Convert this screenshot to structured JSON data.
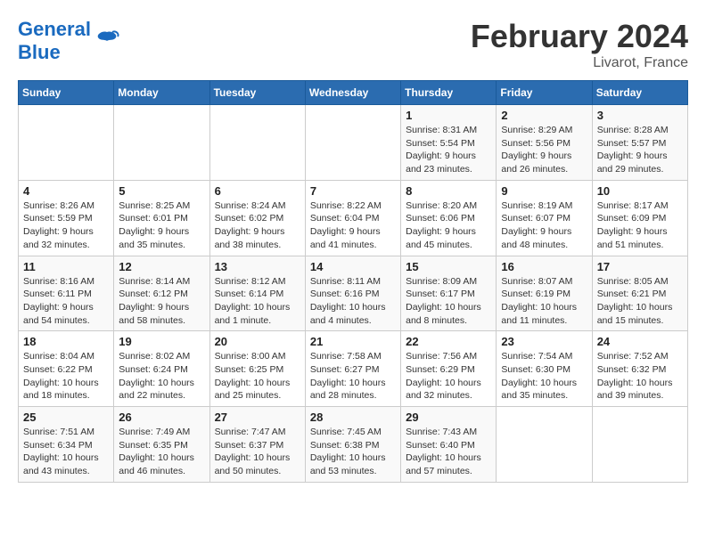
{
  "header": {
    "logo_general": "General",
    "logo_blue": "Blue",
    "month_title": "February 2024",
    "location": "Livarot, France"
  },
  "days_of_week": [
    "Sunday",
    "Monday",
    "Tuesday",
    "Wednesday",
    "Thursday",
    "Friday",
    "Saturday"
  ],
  "weeks": [
    [
      {
        "day": "",
        "info": ""
      },
      {
        "day": "",
        "info": ""
      },
      {
        "day": "",
        "info": ""
      },
      {
        "day": "",
        "info": ""
      },
      {
        "day": "1",
        "info": "Sunrise: 8:31 AM\nSunset: 5:54 PM\nDaylight: 9 hours\nand 23 minutes."
      },
      {
        "day": "2",
        "info": "Sunrise: 8:29 AM\nSunset: 5:56 PM\nDaylight: 9 hours\nand 26 minutes."
      },
      {
        "day": "3",
        "info": "Sunrise: 8:28 AM\nSunset: 5:57 PM\nDaylight: 9 hours\nand 29 minutes."
      }
    ],
    [
      {
        "day": "4",
        "info": "Sunrise: 8:26 AM\nSunset: 5:59 PM\nDaylight: 9 hours\nand 32 minutes."
      },
      {
        "day": "5",
        "info": "Sunrise: 8:25 AM\nSunset: 6:01 PM\nDaylight: 9 hours\nand 35 minutes."
      },
      {
        "day": "6",
        "info": "Sunrise: 8:24 AM\nSunset: 6:02 PM\nDaylight: 9 hours\nand 38 minutes."
      },
      {
        "day": "7",
        "info": "Sunrise: 8:22 AM\nSunset: 6:04 PM\nDaylight: 9 hours\nand 41 minutes."
      },
      {
        "day": "8",
        "info": "Sunrise: 8:20 AM\nSunset: 6:06 PM\nDaylight: 9 hours\nand 45 minutes."
      },
      {
        "day": "9",
        "info": "Sunrise: 8:19 AM\nSunset: 6:07 PM\nDaylight: 9 hours\nand 48 minutes."
      },
      {
        "day": "10",
        "info": "Sunrise: 8:17 AM\nSunset: 6:09 PM\nDaylight: 9 hours\nand 51 minutes."
      }
    ],
    [
      {
        "day": "11",
        "info": "Sunrise: 8:16 AM\nSunset: 6:11 PM\nDaylight: 9 hours\nand 54 minutes."
      },
      {
        "day": "12",
        "info": "Sunrise: 8:14 AM\nSunset: 6:12 PM\nDaylight: 9 hours\nand 58 minutes."
      },
      {
        "day": "13",
        "info": "Sunrise: 8:12 AM\nSunset: 6:14 PM\nDaylight: 10 hours\nand 1 minute."
      },
      {
        "day": "14",
        "info": "Sunrise: 8:11 AM\nSunset: 6:16 PM\nDaylight: 10 hours\nand 4 minutes."
      },
      {
        "day": "15",
        "info": "Sunrise: 8:09 AM\nSunset: 6:17 PM\nDaylight: 10 hours\nand 8 minutes."
      },
      {
        "day": "16",
        "info": "Sunrise: 8:07 AM\nSunset: 6:19 PM\nDaylight: 10 hours\nand 11 minutes."
      },
      {
        "day": "17",
        "info": "Sunrise: 8:05 AM\nSunset: 6:21 PM\nDaylight: 10 hours\nand 15 minutes."
      }
    ],
    [
      {
        "day": "18",
        "info": "Sunrise: 8:04 AM\nSunset: 6:22 PM\nDaylight: 10 hours\nand 18 minutes."
      },
      {
        "day": "19",
        "info": "Sunrise: 8:02 AM\nSunset: 6:24 PM\nDaylight: 10 hours\nand 22 minutes."
      },
      {
        "day": "20",
        "info": "Sunrise: 8:00 AM\nSunset: 6:25 PM\nDaylight: 10 hours\nand 25 minutes."
      },
      {
        "day": "21",
        "info": "Sunrise: 7:58 AM\nSunset: 6:27 PM\nDaylight: 10 hours\nand 28 minutes."
      },
      {
        "day": "22",
        "info": "Sunrise: 7:56 AM\nSunset: 6:29 PM\nDaylight: 10 hours\nand 32 minutes."
      },
      {
        "day": "23",
        "info": "Sunrise: 7:54 AM\nSunset: 6:30 PM\nDaylight: 10 hours\nand 35 minutes."
      },
      {
        "day": "24",
        "info": "Sunrise: 7:52 AM\nSunset: 6:32 PM\nDaylight: 10 hours\nand 39 minutes."
      }
    ],
    [
      {
        "day": "25",
        "info": "Sunrise: 7:51 AM\nSunset: 6:34 PM\nDaylight: 10 hours\nand 43 minutes."
      },
      {
        "day": "26",
        "info": "Sunrise: 7:49 AM\nSunset: 6:35 PM\nDaylight: 10 hours\nand 46 minutes."
      },
      {
        "day": "27",
        "info": "Sunrise: 7:47 AM\nSunset: 6:37 PM\nDaylight: 10 hours\nand 50 minutes."
      },
      {
        "day": "28",
        "info": "Sunrise: 7:45 AM\nSunset: 6:38 PM\nDaylight: 10 hours\nand 53 minutes."
      },
      {
        "day": "29",
        "info": "Sunrise: 7:43 AM\nSunset: 6:40 PM\nDaylight: 10 hours\nand 57 minutes."
      },
      {
        "day": "",
        "info": ""
      },
      {
        "day": "",
        "info": ""
      }
    ]
  ]
}
